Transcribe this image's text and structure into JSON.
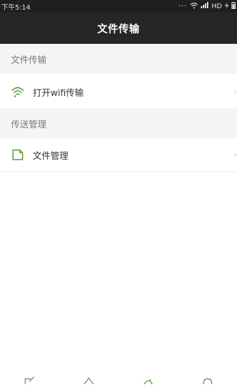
{
  "status_bar": {
    "time": "下午5:14",
    "network": "HD"
  },
  "title_bar": {
    "title": "文件传输"
  },
  "sections": [
    {
      "header": "文件传输",
      "items": [
        {
          "label": "打开wifi传输",
          "icon": "wifi-icon"
        }
      ]
    },
    {
      "header": "传送管理",
      "items": [
        {
          "label": "文件管理",
          "icon": "document-icon"
        }
      ]
    }
  ],
  "tab_bar": {
    "tabs": [
      {
        "icon": "edit-icon",
        "active": false
      },
      {
        "icon": "home-icon",
        "active": false
      },
      {
        "icon": "transfer-icon",
        "active": true
      },
      {
        "icon": "gear-icon",
        "active": false
      }
    ]
  },
  "colors": {
    "accent": "#6aa84f",
    "title_bg": "#262626",
    "section_bg": "#f5f5f5"
  }
}
